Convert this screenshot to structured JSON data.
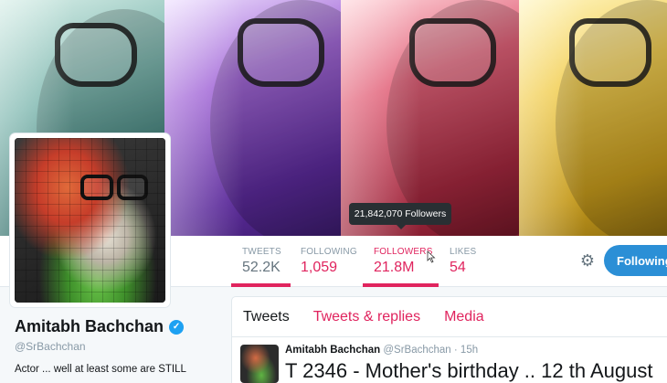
{
  "tooltip": {
    "text": "21,842,070 Followers"
  },
  "stats": [
    {
      "label": "TWEETS",
      "value": "52.2K"
    },
    {
      "label": "FOLLOWING",
      "value": "1,059"
    },
    {
      "label": "FOLLOWERS",
      "value": "21.8M"
    },
    {
      "label": "LIKES",
      "value": "54"
    }
  ],
  "actions": {
    "settings_icon": "gear-icon",
    "follow_label": "Following"
  },
  "profile": {
    "name": "Amitabh Bachchan",
    "verified_icon": "check-icon",
    "handle": "@SrBachchan",
    "bio": "Actor ... well at least some are STILL"
  },
  "tabs": [
    {
      "label": "Tweets"
    },
    {
      "label": "Tweets & replies"
    },
    {
      "label": "Media"
    }
  ],
  "tweet": {
    "author": "Amitabh Bachchan",
    "handle": "@SrBachchan",
    "time": "· 15h",
    "text": "T 2346 - Mother's birthday .. 12 th August"
  },
  "colors": {
    "accent": "#e0245e",
    "follow_button": "#2b8fd6",
    "verified": "#1da1f2"
  }
}
